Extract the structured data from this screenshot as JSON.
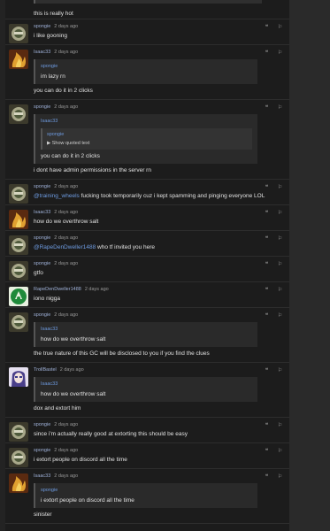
{
  "top": {
    "text": "this is really hot"
  },
  "actions": {
    "quote_glyph": "❝",
    "flag_glyph": "⚐"
  },
  "posts": [
    {
      "user": "spongie",
      "time": "2 days ago",
      "avatar": "sticker-icon",
      "text": "i like gooning"
    },
    {
      "user": "Isaac33",
      "time": "2 days ago",
      "avatar": "fire-icon",
      "quote_user": "spongie",
      "quote_text": "im lazy rn",
      "text": "you can do it in 2 clicks"
    },
    {
      "user": "spongie",
      "time": "2 days ago",
      "avatar": "sticker-icon",
      "quote_user": "Isaac33",
      "inner_quote_user": "spongie",
      "show_quoted": "▶ Show quoted text",
      "quote_text": "you can do it in 2 clicks",
      "text": "i dont have admin permissions in the server rn"
    },
    {
      "user": "spongie",
      "time": "2 days ago",
      "avatar": "sticker-icon",
      "mention": "@training_wheels",
      "text": " fucking took temporarily cuz i kept spamming and pinging everyone LOL"
    },
    {
      "user": "Isaac33",
      "time": "2 days ago",
      "avatar": "fire-icon",
      "text": "how do we overthrow salt"
    },
    {
      "user": "spongie",
      "time": "2 days ago",
      "avatar": "sticker-icon",
      "mention": "@RapeDenDweller1488",
      "text": " who tf invited you here"
    },
    {
      "user": "spongie",
      "time": "2 days ago",
      "avatar": "sticker-icon",
      "text": "gtfo"
    },
    {
      "user": "RapeDenDweller1488",
      "time": "2 days ago",
      "avatar": "green-logo-icon",
      "text": "iono nigga"
    },
    {
      "user": "spongie",
      "time": "2 days ago",
      "avatar": "sticker-icon",
      "quote_user": "Isaac33",
      "quote_text": "how do we overthrow salt",
      "text": "the true nature of this GC will be disclosed to you if you find the clues"
    },
    {
      "user": "TrollBastel",
      "time": "2 days ago",
      "avatar": "anime-icon",
      "quote_user": "Isaac33",
      "quote_text": "how do we overthrow salt",
      "text": "dox and extort him"
    },
    {
      "user": "spongie",
      "time": "2 days ago",
      "avatar": "sticker-icon",
      "text": "since i'm actually really good at extorting this should be easy"
    },
    {
      "user": "spongie",
      "time": "2 days ago",
      "avatar": "sticker-icon",
      "text": "i extort people on discord all the time"
    },
    {
      "user": "Isaac33",
      "time": "2 days ago",
      "avatar": "fire-icon",
      "quote_user": "spongie",
      "quote_text": "i extort people on discord all the time",
      "text": "sinister"
    }
  ]
}
